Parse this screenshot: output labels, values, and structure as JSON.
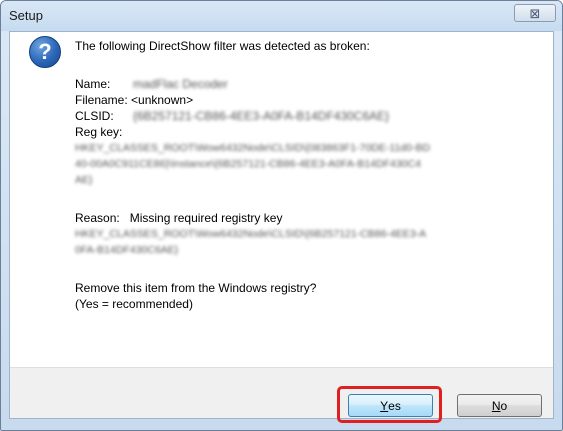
{
  "window": {
    "title": "Setup",
    "close_symbol": "⊠"
  },
  "message": {
    "heading": "The following DirectShow filter was detected as broken:",
    "name_label": "Name:",
    "name_value": "madFlac Decoder",
    "filename_label": "Filename:",
    "filename_value": "<unknown>",
    "clsid_label": "CLSID:",
    "clsid_value": "{6B257121-CB86-4EE3-A0FA-B14DF430C6AE}",
    "regkey_label": "Reg key:",
    "regkey_lines": [
      "HKEY_CLASSES_ROOT\\Wow6432Node\\CLSID\\{083863F1-70DE-11d0-BD",
      "40-00A0C911CE86}\\Instance\\{6B257121-CB86-4EE3-A0FA-B14DF430C4",
      "AE}"
    ],
    "reason_label": "Reason:",
    "reason_value": "Missing required registry key",
    "reason_lines": [
      "HKEY_CLASSES_ROOT\\Wow6432Node\\CLSID\\{6B257121-CB86-4EE3-A",
      "0FA-B14DF430C6AE}"
    ],
    "question": "Remove this item from the Windows registry?",
    "recommendation": "(Yes = recommended)"
  },
  "buttons": {
    "yes_mnemonic": "Y",
    "yes_rest": "es",
    "no_mnemonic": "N",
    "no_rest": "o"
  },
  "colors": {
    "highlight": "#e02020",
    "icon_blue": "#2a66b8"
  }
}
